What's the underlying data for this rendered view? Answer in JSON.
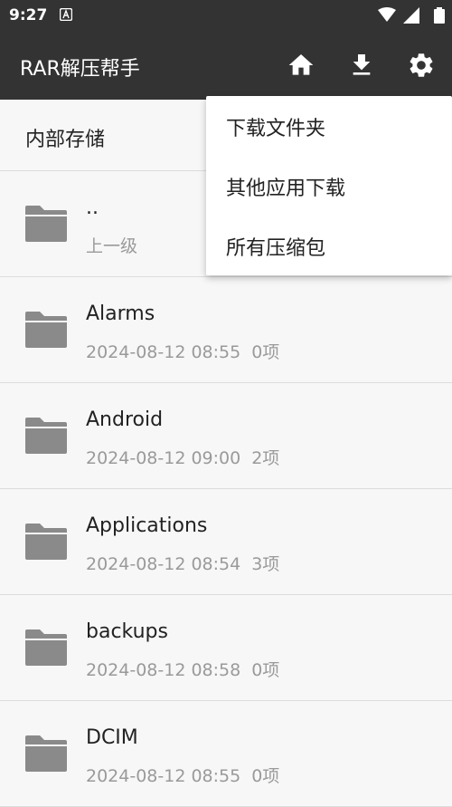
{
  "status_bar": {
    "time": "9:27"
  },
  "app_bar": {
    "title": "RAR解压帮手",
    "actions": [
      "home-icon",
      "download-icon",
      "settings-icon"
    ]
  },
  "path": {
    "label": "内部存储"
  },
  "menu": {
    "items": [
      "下载文件夹",
      "其他应用下载",
      "所有压缩包"
    ]
  },
  "files": [
    {
      "name": "..",
      "date": "上一级",
      "count": ""
    },
    {
      "name": "Alarms",
      "date": "2024-08-12 08:55",
      "count": "0项"
    },
    {
      "name": "Android",
      "date": "2024-08-12 09:00",
      "count": "2项"
    },
    {
      "name": "Applications",
      "date": "2024-08-12 08:54",
      "count": "3项"
    },
    {
      "name": "backups",
      "date": "2024-08-12 08:58",
      "count": "0项"
    },
    {
      "name": "DCIM",
      "date": "2024-08-12 08:55",
      "count": "0项"
    }
  ],
  "colors": {
    "app_bar": "#333333",
    "background": "#f7f7f7",
    "folder": "#8a8a8a",
    "meta_text": "#9a9a9a"
  }
}
